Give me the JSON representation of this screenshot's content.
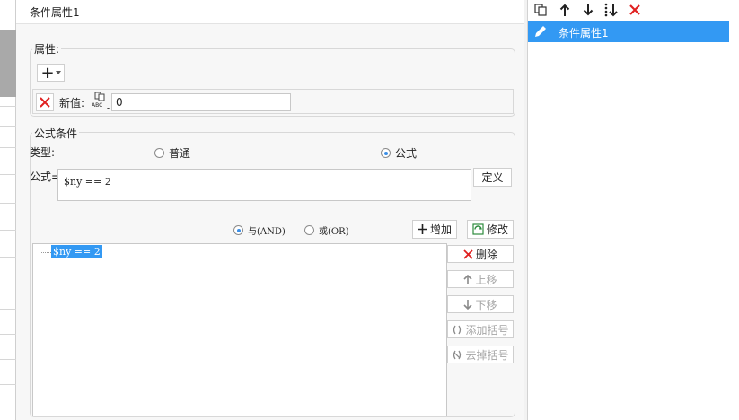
{
  "dialog": {
    "title": "条件属性1"
  },
  "attributes": {
    "group_label": "属性:",
    "add_symbol": "+",
    "new_value_label": "新值:",
    "new_value": "0",
    "abc_icon_label": "ABC"
  },
  "formula_condition": {
    "group_label": "公式条件",
    "type_label": "类型:",
    "radio_normal": "普通",
    "radio_formula": "公式",
    "selected_type": "公式",
    "formula_label": "公式=",
    "formula_value": "$ny == 2",
    "define_button": "定义",
    "and_label": "与(AND)",
    "or_label": "或(OR)",
    "selected_logic": "AND",
    "add_button": "增加",
    "modify_button": "修改",
    "conditions": [
      "$ny == 2"
    ],
    "delete_button": "删除",
    "move_up_button": "上移",
    "move_down_button": "下移",
    "add_bracket_button": "添加括号",
    "remove_bracket_button": "去掉括号"
  },
  "right_panel": {
    "toolbar_icons": [
      "copy-icon",
      "arrow-up-icon",
      "arrow-down-icon",
      "sort-icon",
      "delete-icon"
    ],
    "items": [
      {
        "label": "条件属性1",
        "selected": true
      }
    ]
  },
  "colors": {
    "selection": "#3399f3",
    "delete_red": "#e02020",
    "accent_blue": "#3a8ee6"
  }
}
